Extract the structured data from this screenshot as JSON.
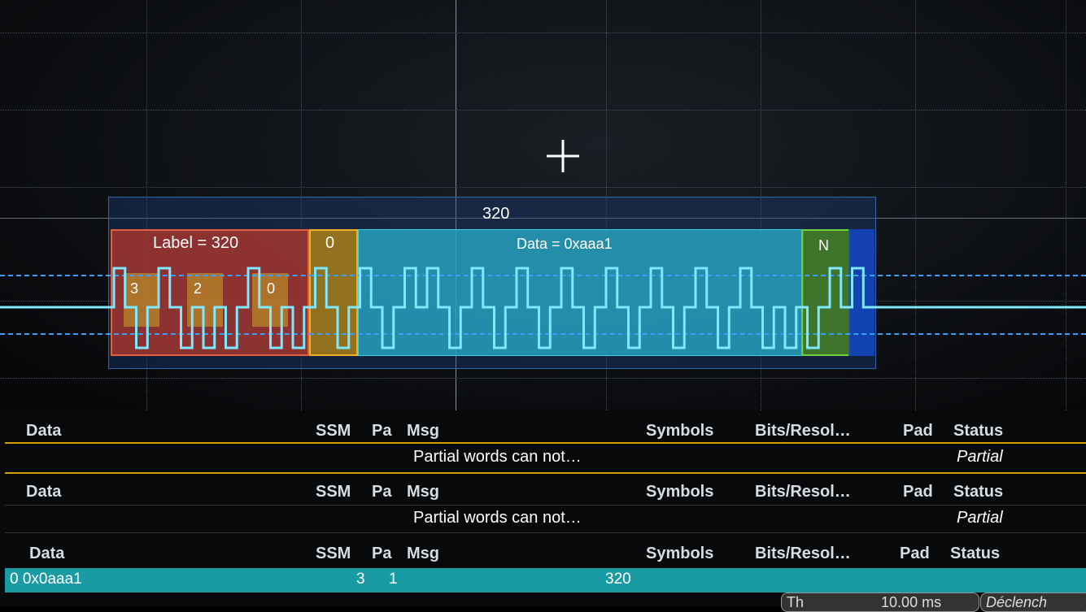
{
  "scope": {
    "frame_value": "320",
    "segments": {
      "label": "Label = 320",
      "ssm": "0",
      "data": "Data = 0xaaa1",
      "parity": "N"
    },
    "digits": [
      "3",
      "2",
      "0"
    ]
  },
  "table": {
    "headers": [
      "Data",
      "SSM",
      "Pa",
      "Msg",
      "Symbols",
      "Bits/Resol…",
      "Pad",
      "Status"
    ],
    "rows": [
      {
        "msg": "Partial words can not…",
        "status": "Partial"
      },
      {
        "msg": "Partial words can not…",
        "status": "Partial"
      },
      {
        "data": "0 0x0aaa1",
        "ssm": "3",
        "pa": "1",
        "symbols": "320"
      }
    ]
  },
  "footer": {
    "time_label": "Th",
    "time_value": "10.00 ms",
    "trigger_label": "Déclench"
  },
  "colors": {
    "label_segment": "#af372d",
    "ssm_segment": "#be8c14",
    "data_segment": "#28aac8",
    "parity_segment": "#468228",
    "trace": "#7fe8ff",
    "selected_row": "#1a9aa3",
    "header_separator": "#d2a000"
  }
}
